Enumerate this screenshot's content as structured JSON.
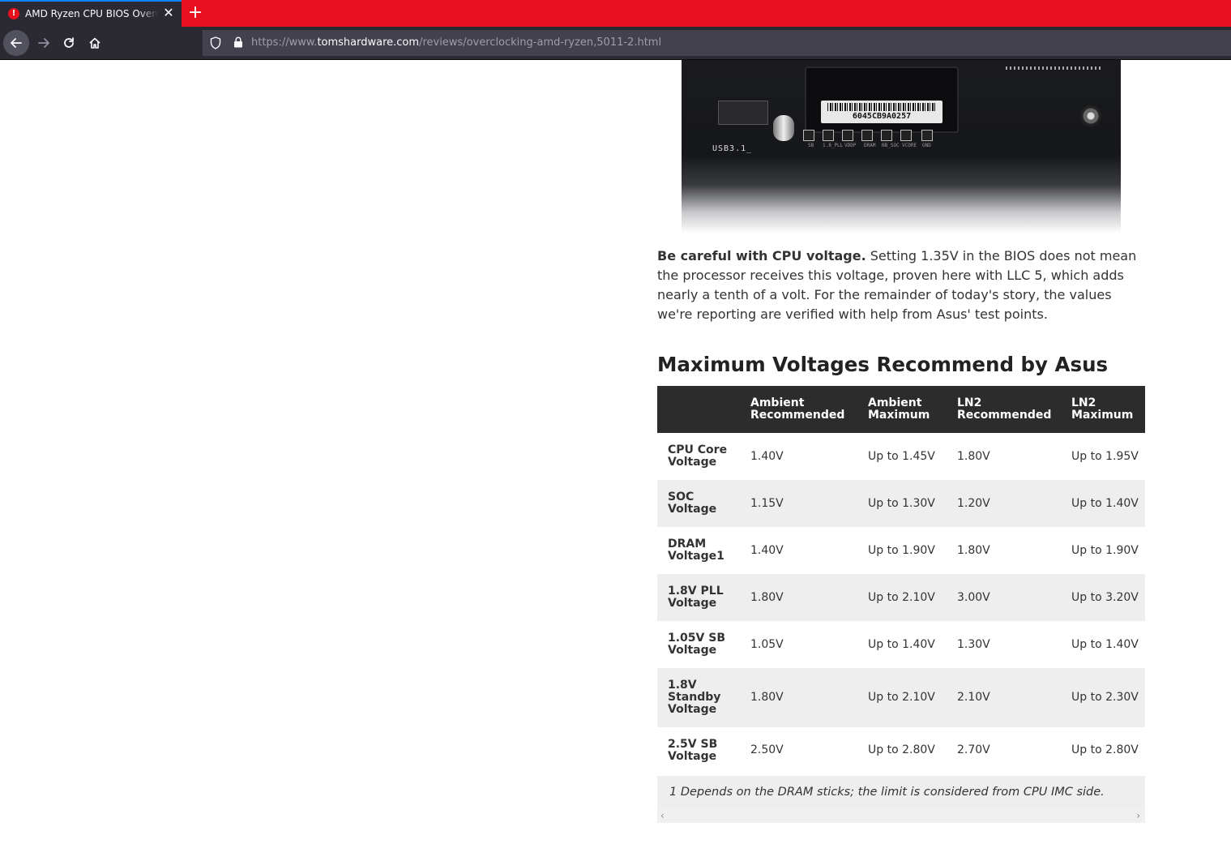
{
  "browser": {
    "tab_title": "AMD Ryzen CPU BIOS Overclocking",
    "tab_close": "✕",
    "new_tab": "+",
    "url_prefix": "https://www.",
    "url_domain": "tomshardware.com",
    "url_path": "/reviews/overclocking-amd-ryzen,5011-2.html"
  },
  "image": {
    "barcode_text": "6045CB9A0257",
    "usb_label": "USB3.1_",
    "testpoint_labels": [
      "SB",
      "1.8_PLL",
      "VDDP",
      "DRAM",
      "NB_SOC",
      "VCORE",
      "GND"
    ]
  },
  "article": {
    "lead": "Be careful with CPU voltage.",
    "body": " Setting 1.35V in the BIOS does not mean the processor receives this voltage, proven here with LLC 5, which adds nearly a tenth of a volt. For the remainder of today's story, the values we're reporting are verified with help from Asus' test points.",
    "heading": "Maximum Voltages Recommend by Asus"
  },
  "table": {
    "headers": [
      "",
      "Ambient Recommended",
      "Ambient Maximum",
      "LN2 Recommended",
      "LN2 Maximum"
    ],
    "rows": [
      [
        "CPU Core Voltage",
        "1.40V",
        "Up to 1.45V",
        "1.80V",
        "Up to 1.95V"
      ],
      [
        "SOC Voltage",
        "1.15V",
        "Up to 1.30V",
        "1.20V",
        "Up to 1.40V"
      ],
      [
        "DRAM Voltage1",
        "1.40V",
        "Up to 1.90V",
        "1.80V",
        "Up to 1.90V"
      ],
      [
        "1.8V PLL Voltage",
        "1.80V",
        "Up to 2.10V",
        "3.00V",
        "Up to 3.20V"
      ],
      [
        "1.05V SB Voltage",
        "1.05V",
        "Up to 1.40V",
        "1.30V",
        "Up to 1.40V"
      ],
      [
        "1.8V Standby Voltage",
        "1.80V",
        "Up to 2.10V",
        "2.10V",
        "Up to 2.30V"
      ],
      [
        "2.5V SB Voltage",
        "2.50V",
        "Up to 2.80V",
        "2.70V",
        "Up to 2.80V"
      ]
    ],
    "footnote": "1 Depends on the DRAM sticks; the limit is considered from CPU IMC side."
  },
  "icons": {
    "back": "back-arrow-icon",
    "forward": "forward-arrow-icon",
    "reload": "reload-icon",
    "home": "home-icon",
    "shield": "shield-icon",
    "lock": "lock-icon"
  },
  "colors": {
    "tabstrip": "#e8101f",
    "toolbar": "#2b2a33",
    "table_header": "#2c2c2c",
    "row_alt": "#eeeeee"
  }
}
